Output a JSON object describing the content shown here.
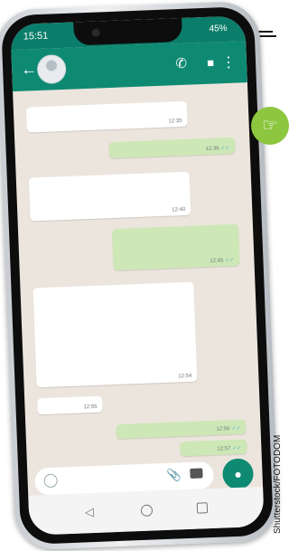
{
  "status": {
    "time": "15:51",
    "right": "45%"
  },
  "messages": [
    {
      "dir": "in",
      "time": "12:35"
    },
    {
      "dir": "out",
      "time": "12:36"
    },
    {
      "dir": "in",
      "time": "12:40"
    },
    {
      "dir": "out",
      "time": "12:45"
    },
    {
      "dir": "in",
      "time": "12:54"
    },
    {
      "dir": "in",
      "time": "12:55"
    },
    {
      "dir": "out",
      "time": "12:56"
    },
    {
      "dir": "out",
      "time": "12:57"
    }
  ],
  "credit": "Shutterstock/FOTODOM"
}
